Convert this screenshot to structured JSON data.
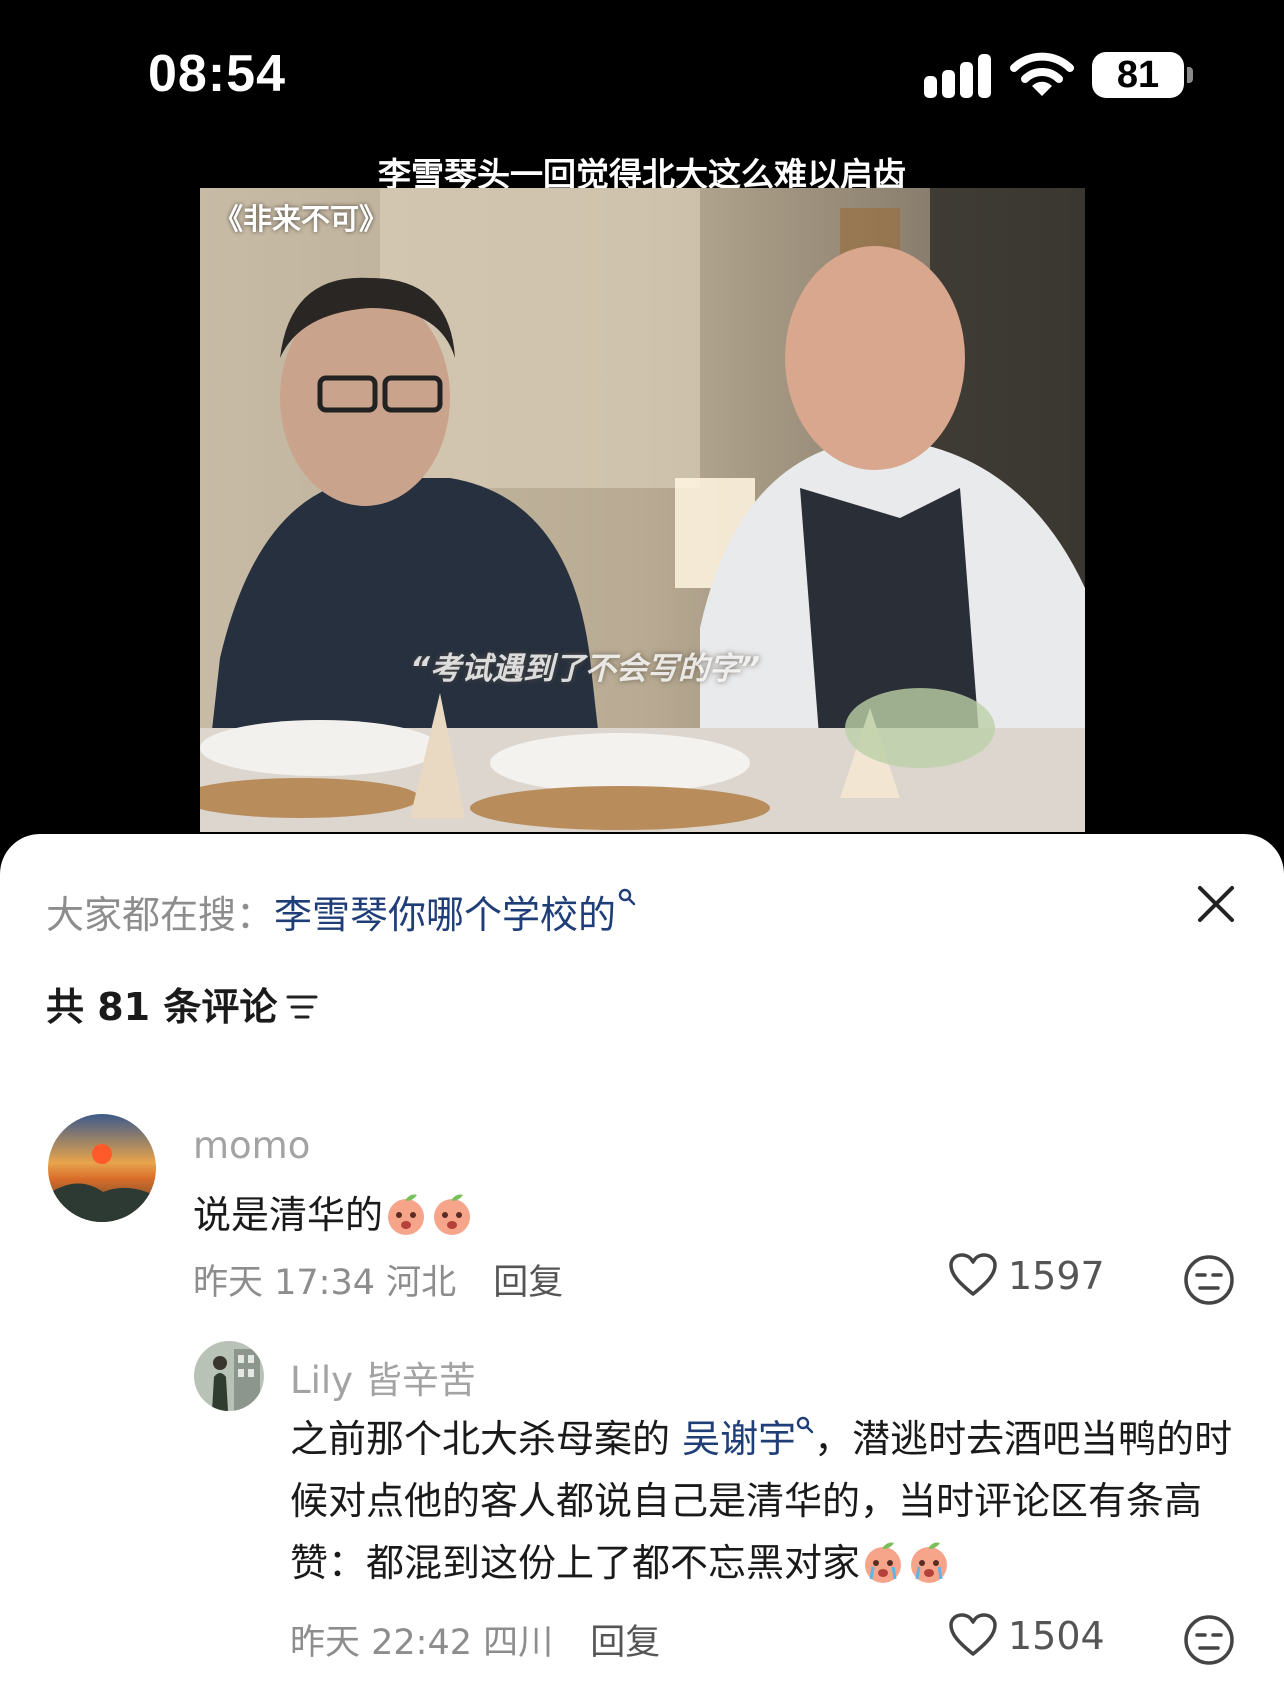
{
  "status_bar": {
    "time": "08:54",
    "battery": "81"
  },
  "video": {
    "title": "李雪琴头一回觉得北大这么难以启齿",
    "show_name": "《非来不可》",
    "subtitle": "“考试遇到了不会写的字”"
  },
  "sheet": {
    "search_label": "大家都在搜：",
    "search_term": "李雪琴你哪个学校的",
    "comment_count": "共 81 条评论"
  },
  "comments": [
    {
      "username": "momo",
      "text": "说是清华的",
      "time": "昨天 17:34",
      "location": "河北",
      "reply_label": "回复",
      "likes": "1597"
    }
  ],
  "replies": [
    {
      "username": "Lily 皆辛苦",
      "text_before": "之前那个北大杀母案的",
      "mention": "吴谢宇",
      "text_after": "，潜逃时去酒吧当鸭的时候对点他的客人都说自己是清华的，当时评论区有条高赞：都混到这份上了都不忘黑对家",
      "time": "昨天 22:42",
      "location": "四川",
      "reply_label": "回复",
      "likes": "1504"
    }
  ],
  "colors": {
    "link": "#1f3e78",
    "muted": "#8d8d8d",
    "username": "#a3a3a3",
    "emoji": "#f6a58a"
  },
  "icons": [
    "signal-icon",
    "wifi-icon",
    "battery-icon",
    "search-icon",
    "close-icon",
    "sort-icon",
    "heart-icon",
    "dislike-face-icon",
    "crying-peach-emoji"
  ]
}
